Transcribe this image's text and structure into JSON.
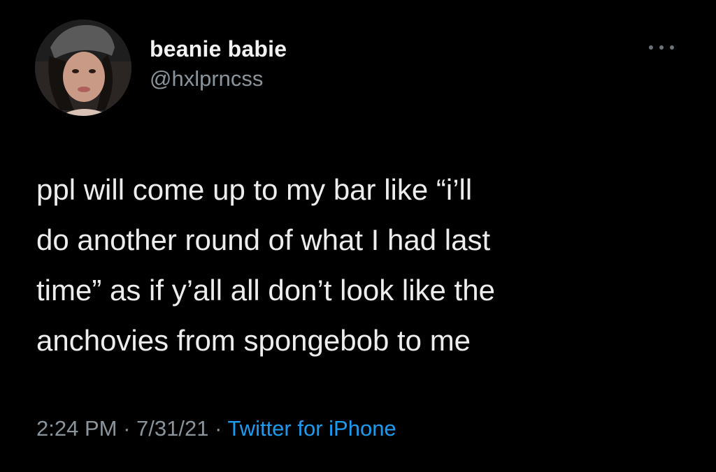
{
  "user": {
    "display_name": "beanie babie",
    "handle": "@hxlprncss",
    "avatar_icon": "profile-photo"
  },
  "more_icon": "more-horizontal-icon",
  "tweet": {
    "lines": [
      "ppl will come up to my bar like “i’ll",
      "do another round of what I had last",
      "time” as if y’all all don’t look like the",
      "anchovies from spongebob to me"
    ]
  },
  "meta": {
    "time": "2:24 PM",
    "separator": " · ",
    "date": "7/31/21",
    "source": "Twitter for iPhone"
  },
  "colors": {
    "background": "#000000",
    "text": "#e7e9ea",
    "secondary": "#8b949a",
    "accent": "#1d9bf0"
  }
}
